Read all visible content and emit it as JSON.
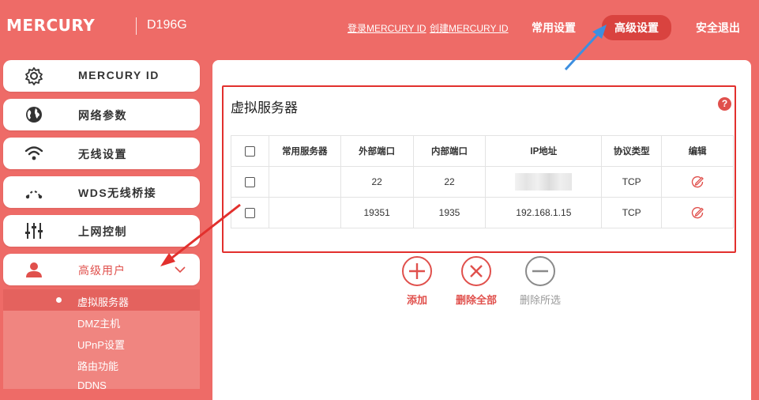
{
  "header": {
    "logo": "MERCURY",
    "model": "D196G",
    "login_link": "登录MERCURY ID",
    "create_link": "创建MERCURY ID",
    "nav_common": "常用设置",
    "nav_advanced": "高级设置",
    "nav_logout": "安全退出"
  },
  "sidebar": {
    "items": [
      {
        "label": "MERCURY ID",
        "icon": "gear-icon"
      },
      {
        "label": "网络参数",
        "icon": "globe-icon"
      },
      {
        "label": "无线设置",
        "icon": "wifi-icon"
      },
      {
        "label": "WDS无线桥接",
        "icon": "bridge-icon"
      },
      {
        "label": "上网控制",
        "icon": "sliders-icon"
      },
      {
        "label": "高级用户",
        "icon": "user-icon"
      }
    ],
    "submenu": [
      "虚拟服务器",
      "DMZ主机",
      "UPnP设置",
      "路由功能",
      "DDNS"
    ]
  },
  "main": {
    "title": "虚拟服务器",
    "help": "?",
    "columns": [
      "常用服务器",
      "外部端口",
      "内部端口",
      "IP地址",
      "协议类型",
      "编辑"
    ],
    "rows": [
      {
        "service": "",
        "ext_port": "22",
        "int_port": "22",
        "ip": "",
        "protocol": "TCP"
      },
      {
        "service": "",
        "ext_port": "19351",
        "int_port": "1935",
        "ip": "192.168.1.15",
        "protocol": "TCP"
      }
    ],
    "actions": {
      "add": "添加",
      "delete_all": "删除全部",
      "delete_selected": "删除所选"
    }
  },
  "colors": {
    "background": "#ee6b67",
    "accent": "#e0504c",
    "annotation": "#e2302d",
    "arrow_blue": "#3d8fe0"
  }
}
